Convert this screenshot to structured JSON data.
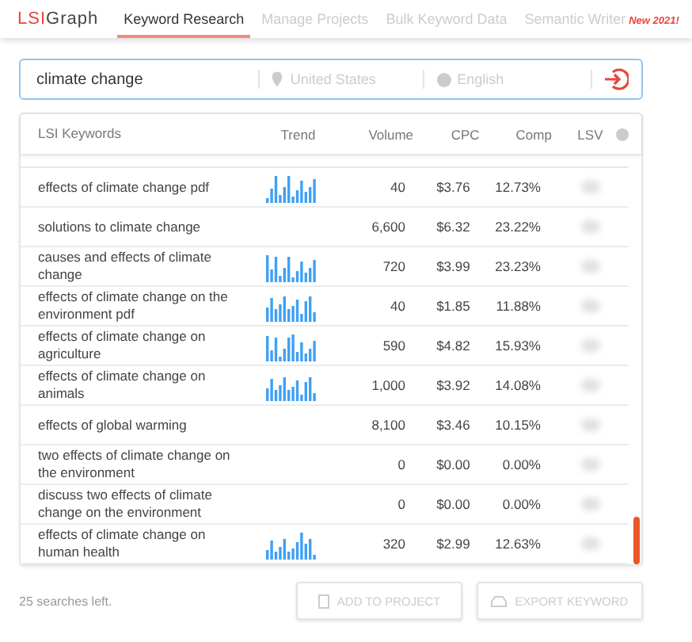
{
  "logo": {
    "accent": "LSI",
    "rest": "Graph"
  },
  "tabs": [
    {
      "label": "Keyword Research",
      "selected": true
    },
    {
      "label": "Manage Projects",
      "selected": false
    },
    {
      "label": "Bulk Keyword Data",
      "selected": false
    },
    {
      "label": "Semantic Writer",
      "selected": false,
      "badge": "New 2021!"
    }
  ],
  "search": {
    "value": "climate change",
    "location_placeholder": "United States",
    "language_placeholder": "English"
  },
  "table": {
    "columns": [
      "LSI Keywords",
      "Trend",
      "Volume",
      "CPC",
      "Comp",
      "LSV"
    ],
    "rows": [
      {
        "keyword": "effects of climate change pdf",
        "trend": true,
        "volume": "40",
        "cpc": "$3.76",
        "comp": "12.73%"
      },
      {
        "keyword": "solutions to climate change",
        "trend": false,
        "volume": "6,600",
        "cpc": "$6.32",
        "comp": "23.22%"
      },
      {
        "keyword": "causes and effects of climate change",
        "trend": true,
        "volume": "720",
        "cpc": "$3.99",
        "comp": "23.23%"
      },
      {
        "keyword": "effects of climate change on the environment pdf",
        "trend": true,
        "volume": "40",
        "cpc": "$1.85",
        "comp": "11.88%"
      },
      {
        "keyword": "effects of climate change on agriculture",
        "trend": true,
        "volume": "590",
        "cpc": "$4.82",
        "comp": "15.93%"
      },
      {
        "keyword": "effects of climate change on animals",
        "trend": true,
        "volume": "1,000",
        "cpc": "$3.92",
        "comp": "14.08%"
      },
      {
        "keyword": "effects of global warming",
        "trend": false,
        "volume": "8,100",
        "cpc": "$3.46",
        "comp": "10.15%"
      },
      {
        "keyword": "two effects of climate change on the environment",
        "trend": false,
        "volume": "0",
        "cpc": "$0.00",
        "comp": "0.00%"
      },
      {
        "keyword": "discuss two effects of climate change on the environment",
        "trend": false,
        "volume": "0",
        "cpc": "$0.00",
        "comp": "0.00%"
      },
      {
        "keyword": "effects of climate change on human health",
        "trend": true,
        "volume": "320",
        "cpc": "$2.99",
        "comp": "12.63%"
      }
    ]
  },
  "footer": {
    "searches_left": "25 searches left.",
    "buttons": [
      {
        "kind": "add",
        "label": "ADD TO PROJECT"
      },
      {
        "kind": "export",
        "label": "EXPORT KEYWORD"
      }
    ]
  }
}
